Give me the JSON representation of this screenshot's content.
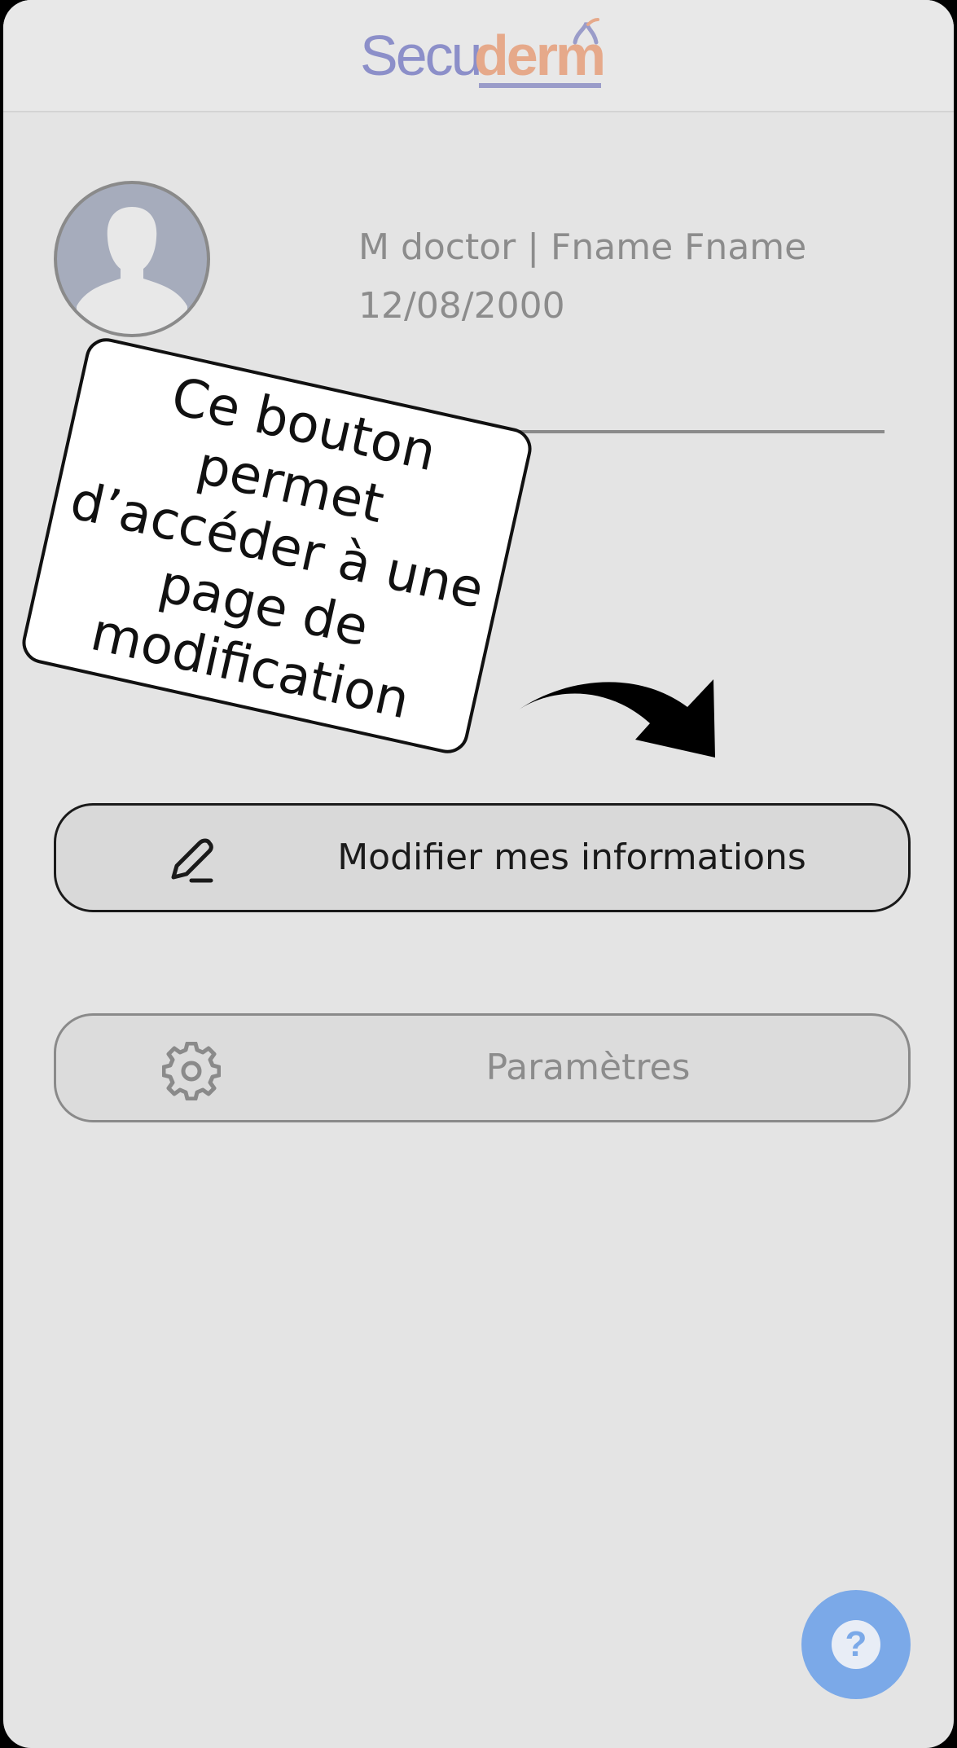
{
  "app": {
    "logo_part1": "Secu",
    "logo_part2": "derm"
  },
  "profile": {
    "name_line": "M doctor | Fname Fname",
    "birthdate": "12/08/2000",
    "avatar_icon": "user-silhouette-icon"
  },
  "tutorial": {
    "callout_text": "Ce bouton permet d’accéder à une page de modification",
    "arrow_icon": "curved-arrow-icon"
  },
  "actions": {
    "edit_label": "Modifier mes informations",
    "edit_icon": "pencil-icon",
    "settings_label": "Paramètres",
    "settings_icon": "gear-icon"
  },
  "help": {
    "icon": "question-mark-icon",
    "glyph": "?"
  },
  "colors": {
    "background": "#e4e4e4",
    "logo_blue": "#8c8fc9",
    "logo_orange": "#e6a98a",
    "help_blue": "#7ba9e8",
    "muted_text": "#8c8c8c"
  }
}
